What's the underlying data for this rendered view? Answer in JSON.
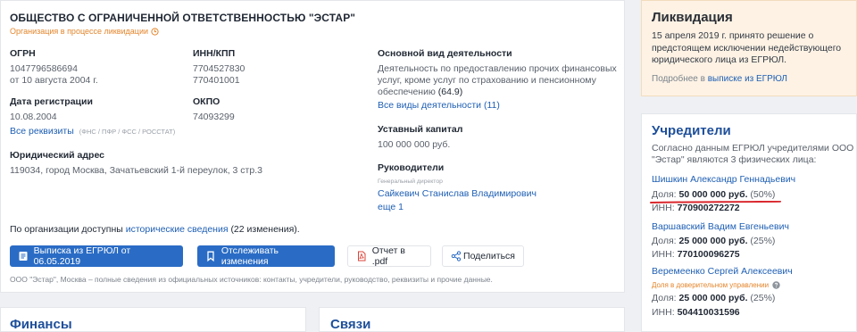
{
  "company": {
    "name": "ОБЩЕСТВО С ОГРАНИЧЕННОЙ ОТВЕТСТВЕННОСТЬЮ \"ЭСТАР\"",
    "status": "Организация в процессе ликвидации",
    "ogrn_label": "ОГРН",
    "ogrn": "1047796586694",
    "ogrn_date": "от 10 августа 2004 г.",
    "inn_kpp_label": "ИНН/КПП",
    "inn": "7704527830",
    "kpp": "770401001",
    "reg_date_label": "Дата регистрации",
    "reg_date": "10.08.2004",
    "okpo_label": "ОКПО",
    "okpo": "74093299",
    "all_requisites": "Все реквизиты",
    "requisites_note": "(ФНС / ПФР / ФСС / РОССТАТ)",
    "address_label": "Юридический адрес",
    "address": "119034, город Москва, Зачатьевский 1-й переулок, 3 стр.3",
    "activity_label": "Основной вид деятельности",
    "activity_line1": "Деятельность по предоставлению прочих финансовых",
    "activity_line2": "услуг, кроме услуг по страхованию и пенсионному",
    "activity_line3": "обеспечению",
    "activity_code": "(64.9)",
    "all_activities": "Все виды деятельности (11)",
    "capital_label": "Уставный капитал",
    "capital": "100 000 000 руб.",
    "heads_label": "Руководители",
    "head_role": "Генеральный директор",
    "head_name": "Сайкевич Станислав Владимирович",
    "more_heads": "еще 1",
    "history_prefix": "По организации доступны",
    "history_link": "исторические сведения",
    "history_suffix": "(22 изменения).",
    "footer_text": "ООО \"Эстар\", Москва – полные сведения из официальных источников: контакты, учредители, руководство, реквизиты и прочие данные."
  },
  "buttons": {
    "egrul": "Выписка из ЕГРЮЛ от 06.05.2019",
    "track": "Отслеживать изменения",
    "pdf": "Отчет в .pdf",
    "share": "Поделиться"
  },
  "liquidation": {
    "title": "Ликвидация",
    "text": "15 апреля 2019 г. принято решение о предстоящем исключении недействующего юридического лица из ЕГРЮЛ.",
    "more_prefix": "Подробнее в",
    "more_link": "выписке из ЕГРЮЛ"
  },
  "founders": {
    "title": "Учредители",
    "intro_line1": "Согласно данным ЕГРЮЛ учредителями ООО",
    "intro_line2": "\"Эстар\" являются 3 физических лица:",
    "share_label": "Доля:",
    "inn_label": "ИНН:",
    "trust_note": "Доля в доверительном управлении",
    "items": [
      {
        "name": "Шишкин Александр Геннадьевич",
        "share": "50 000 000 руб.",
        "percent": "(50%)",
        "inn": "770900272272"
      },
      {
        "name": "Варшавский Вадим Евгеньевич",
        "share": "25 000 000 руб.",
        "percent": "(25%)",
        "inn": "770100096275"
      },
      {
        "name": "Веремеенко Сергей Алексеевич",
        "share": "25 000 000 руб.",
        "percent": "(25%)",
        "inn": "504410031596"
      }
    ]
  },
  "sections": {
    "finances": "Финансы",
    "connections": "Связи"
  },
  "colors": {
    "primary": "#2a6cc5",
    "link": "#1e5fb4",
    "orange": "#e4852b",
    "red_underline": "#d9252b"
  },
  "icons": [
    "clock-icon",
    "document-icon",
    "bookmark-icon",
    "pdf-icon",
    "share-icon",
    "question-icon"
  ]
}
